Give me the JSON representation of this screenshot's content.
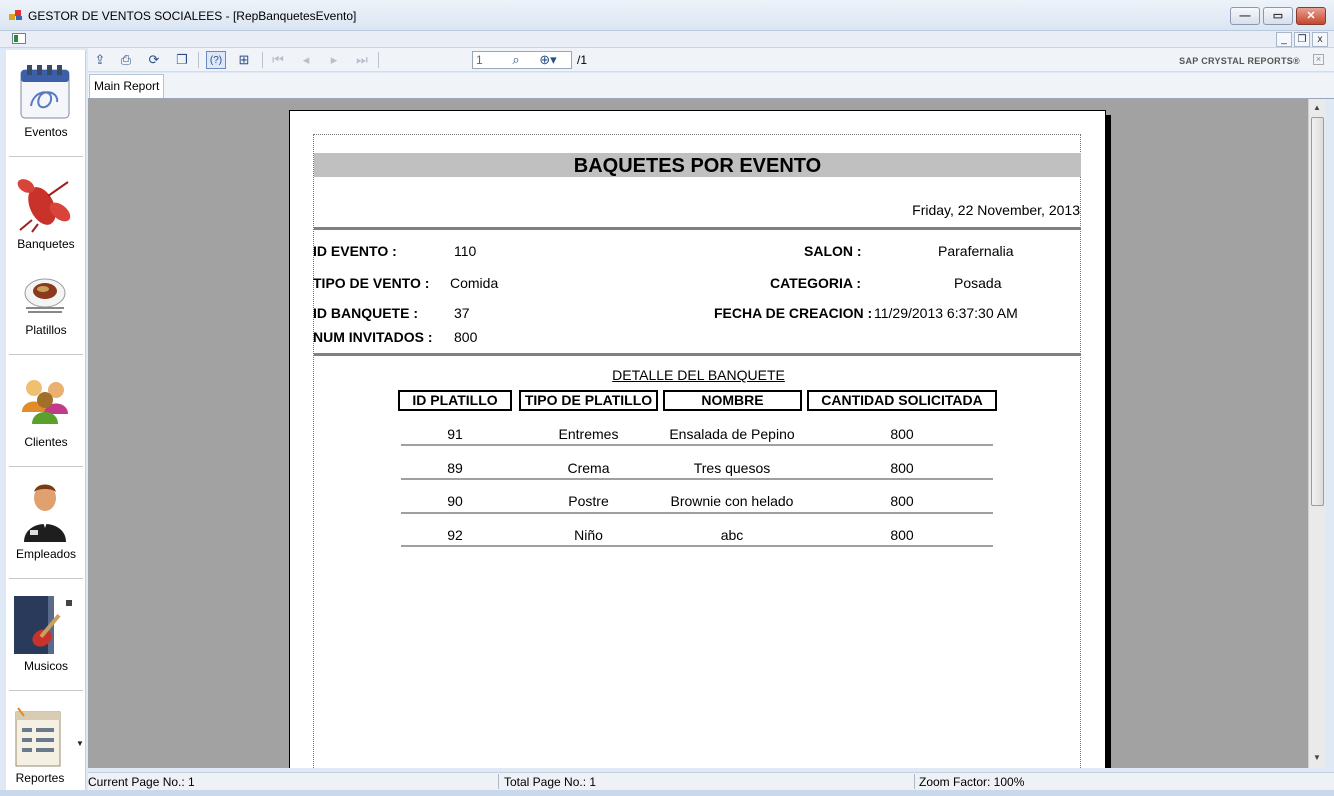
{
  "window": {
    "title": "GESTOR DE VENTOS SOCIALEES - [RepBanquetesEvento]",
    "minimize": "—",
    "maximize": "▭",
    "close": "✕"
  },
  "mdi": {
    "minimize": "_",
    "restore": "❐",
    "close": "x"
  },
  "sidebar": {
    "items": [
      {
        "label": "Eventos",
        "icon": "calendar-icon"
      },
      {
        "label": "Banquetes",
        "icon": "lobster-icon"
      },
      {
        "label": "Platillos",
        "icon": "plate-icon"
      },
      {
        "label": "Clientes",
        "icon": "people-icon"
      },
      {
        "label": "Empleados",
        "icon": "employee-icon"
      },
      {
        "label": "Musicos",
        "icon": "guitar-icon"
      },
      {
        "label": "Reportes",
        "icon": "report-icon"
      }
    ]
  },
  "toolbar": {
    "page_value": "1",
    "page_total": "/1",
    "brand": "SAP CRYSTAL REPORTS®",
    "icons": [
      "export-icon",
      "print-icon",
      "refresh-icon",
      "copy-icon",
      "help-icon",
      "group-tree-icon",
      "first-page-icon",
      "prev-page-icon",
      "next-page-icon",
      "last-page-icon",
      "find-icon",
      "zoom-icon"
    ]
  },
  "tabs": {
    "main": "Main Report"
  },
  "report": {
    "title": "BAQUETES POR EVENTO",
    "date": "Friday, 22 November, 2013",
    "fields": {
      "id_evento_label": "ID EVENTO :",
      "id_evento_value": "110",
      "salon_label": "SALON :",
      "salon_value": "Parafernalia",
      "tipo_label": "TIPO DE VENTO :",
      "tipo_value": "Comida",
      "categoria_label": "CATEGORIA :",
      "categoria_value": "Posada",
      "id_banquete_label": "ID BANQUETE :",
      "id_banquete_value": "37",
      "fecha_label": "FECHA DE CREACION :",
      "fecha_value": "11/29/2013 6:37:30 AM",
      "num_invitados_label": "NUM INVITADOS :",
      "num_invitados_value": "800"
    },
    "detail_title": "DETALLE DEL BANQUETE",
    "columns": [
      "ID PLATILLO",
      "TIPO DE PLATILLO",
      "NOMBRE",
      "CANTIDAD SOLICITADA"
    ],
    "rows": [
      [
        "91",
        "Entremes",
        "Ensalada de Pepino",
        "800"
      ],
      [
        "89",
        "Crema",
        "Tres quesos",
        "800"
      ],
      [
        "90",
        "Postre",
        "Brownie con helado",
        "800"
      ],
      [
        "92",
        "Niño",
        "abc",
        "800"
      ]
    ]
  },
  "status": {
    "current_page": "Current Page No.: 1",
    "total_page": "Total Page No.: 1",
    "zoom": "Zoom Factor: 100%"
  }
}
